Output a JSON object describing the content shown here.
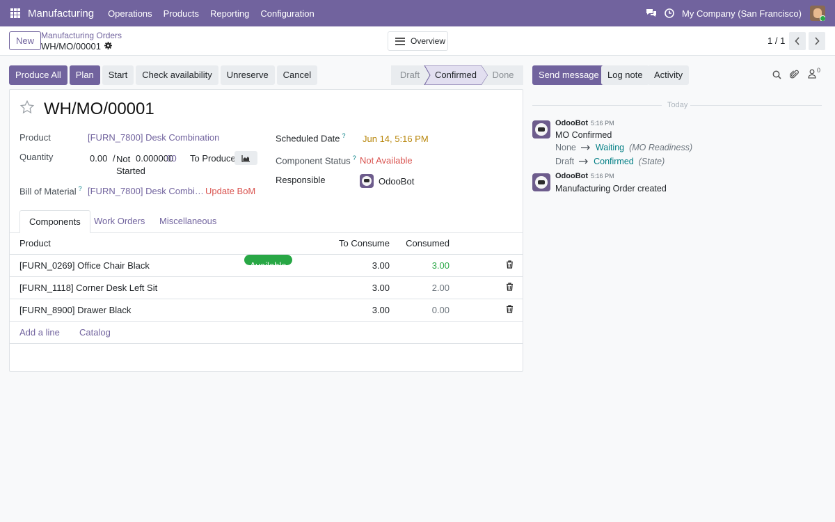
{
  "nav": {
    "app_name": "Manufacturing",
    "menu": [
      "Operations",
      "Products",
      "Reporting",
      "Configuration"
    ],
    "company": "My Company (San Francisco)"
  },
  "control": {
    "new_label": "New",
    "breadcrumb_parent": "Manufacturing Orders",
    "breadcrumb_current": "WH/MO/00001",
    "overview_label": "Overview",
    "pager": "1 / 1"
  },
  "actions": [
    "Produce All",
    "Plan",
    "Start",
    "Check availability",
    "Unreserve",
    "Cancel"
  ],
  "status": {
    "stages": [
      "Draft",
      "Confirmed",
      "Done"
    ],
    "current": "Confirmed"
  },
  "form": {
    "title": "WH/MO/00001",
    "product_label": "Product",
    "product_value": "[FURN_7800] Desk Combination",
    "quantity_label": "Quantity",
    "quantity_value": "0.00",
    "qty_separator": "/",
    "qty_not_started": "Not Started",
    "qty_total": "0.000000",
    "qty_total_suffix": "00",
    "to_produce_label": "To Produce",
    "bom_label": "Bill of Material",
    "bom_value": "[FURN_7800] Desk Combi…",
    "update_bom": "Update BoM",
    "scheduled_label": "Scheduled Date",
    "scheduled_value": "Jun 14, 5:16 PM",
    "component_status_label": "Component Status",
    "component_status_value": "Not Available",
    "responsible_label": "Responsible",
    "responsible_value": "OdooBot",
    "help_marker": "?"
  },
  "tabs": [
    "Components",
    "Work Orders",
    "Miscellaneous"
  ],
  "components": {
    "headers": [
      "Product",
      "To Consume",
      "Consumed"
    ],
    "rows": [
      {
        "product": "[FURN_0269] Office Chair Black",
        "badge": "Available",
        "to_consume": "3.00",
        "consumed": "3.00",
        "consumed_color": "#28a745"
      },
      {
        "product": "[FURN_1118] Corner Desk Left Sit",
        "badge": "",
        "to_consume": "3.00",
        "consumed": "2.00",
        "consumed_color": "#6c757d"
      },
      {
        "product": "[FURN_8900] Drawer Black",
        "badge": "",
        "to_consume": "3.00",
        "consumed": "0.00",
        "consumed_color": "#6c757d"
      }
    ],
    "add_line": "Add a line",
    "catalog": "Catalog"
  },
  "chatter": {
    "send_message": "Send message",
    "log_note": "Log note",
    "activity": "Activity",
    "followers_count": "0",
    "today": "Today",
    "messages": [
      {
        "author": "OdooBot",
        "time": "5:16 PM",
        "text": "MO Confirmed",
        "tracking": [
          {
            "old": "None",
            "new": "Waiting",
            "field": "(MO Readiness)"
          },
          {
            "old": "Draft",
            "new": "Confirmed",
            "field": "(State)"
          }
        ]
      },
      {
        "author": "OdooBot",
        "time": "5:16 PM",
        "text": "Manufacturing Order created"
      }
    ]
  },
  "colors": {
    "brand": "#71639e",
    "available": "#28a745",
    "warning_date": "#b8860b",
    "danger": "#d9534f",
    "teal": "#017e84"
  }
}
